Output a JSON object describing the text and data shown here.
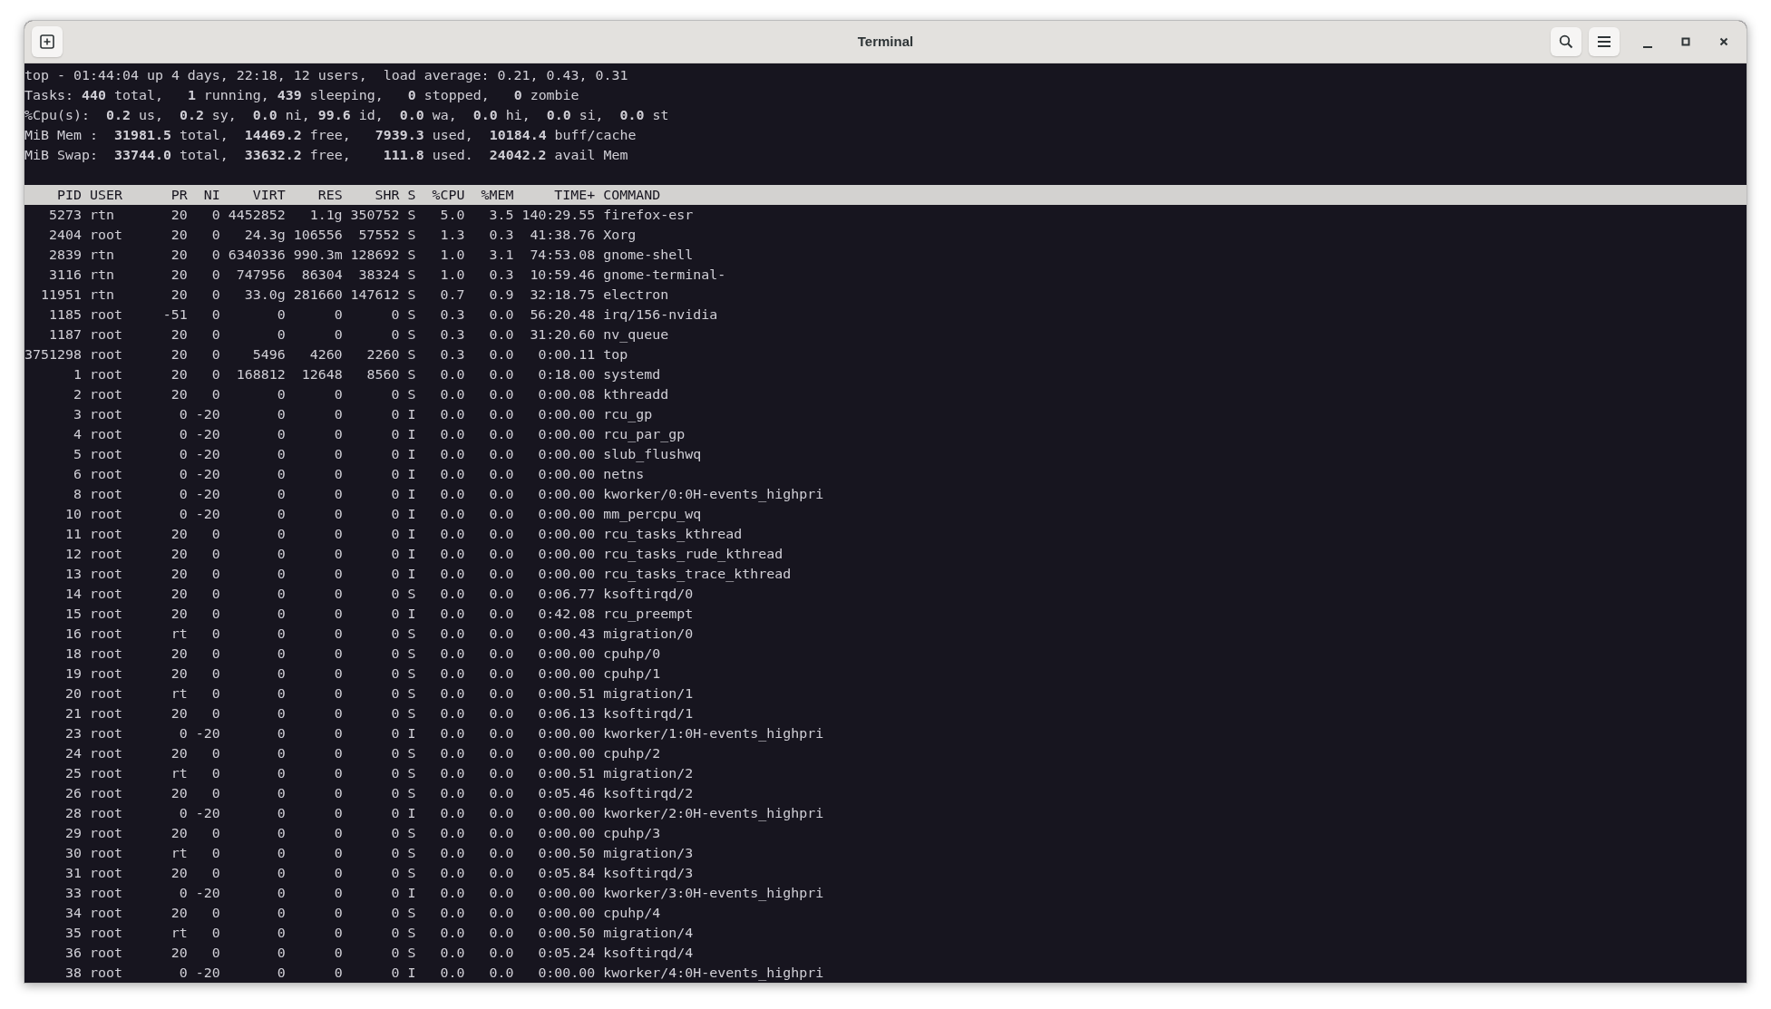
{
  "window": {
    "title": "Terminal"
  },
  "summary": [
    "top - 01:44:04 up 4 days, 22:18, 12 users,  load average: 0.21, 0.43, 0.31",
    "Tasks: **440** total,   **1** running, **439** sleeping,   **0** stopped,   **0** zombie",
    "%Cpu(s):  **0.2** us,  **0.2** sy,  **0.0** ni, **99.6** id,  **0.0** wa,  **0.0** hi,  **0.0** si,  **0.0** st",
    "MiB Mem :  **31981.5** total,  **14469.2** free,   **7939.3** used,  **10184.4** buff/cache",
    "MiB Swap:  **33744.0** total,  **33632.2** free,    **111.8** used.  **24042.2** avail Mem"
  ],
  "table": {
    "columns": [
      "PID",
      "USER",
      "PR",
      "NI",
      "VIRT",
      "RES",
      "SHR",
      "S",
      "%CPU",
      "%MEM",
      "TIME+",
      "COMMAND"
    ],
    "rows": [
      [
        "5273",
        "rtn",
        "20",
        "0",
        "4452852",
        "1.1g",
        "350752",
        "S",
        "5.0",
        "3.5",
        "140:29.55",
        "firefox-esr"
      ],
      [
        "2404",
        "root",
        "20",
        "0",
        "24.3g",
        "106556",
        "57552",
        "S",
        "1.3",
        "0.3",
        "41:38.76",
        "Xorg"
      ],
      [
        "2839",
        "rtn",
        "20",
        "0",
        "6340336",
        "990.3m",
        "128692",
        "S",
        "1.0",
        "3.1",
        "74:53.08",
        "gnome-shell"
      ],
      [
        "3116",
        "rtn",
        "20",
        "0",
        "747956",
        "86304",
        "38324",
        "S",
        "1.0",
        "0.3",
        "10:59.46",
        "gnome-terminal-"
      ],
      [
        "11951",
        "rtn",
        "20",
        "0",
        "33.0g",
        "281660",
        "147612",
        "S",
        "0.7",
        "0.9",
        "32:18.75",
        "electron"
      ],
      [
        "1185",
        "root",
        "-51",
        "0",
        "0",
        "0",
        "0",
        "S",
        "0.3",
        "0.0",
        "56:20.48",
        "irq/156-nvidia"
      ],
      [
        "1187",
        "root",
        "20",
        "0",
        "0",
        "0",
        "0",
        "S",
        "0.3",
        "0.0",
        "31:20.60",
        "nv_queue"
      ],
      [
        "3751298",
        "root",
        "20",
        "0",
        "5496",
        "4260",
        "2260",
        "S",
        "0.3",
        "0.0",
        "0:00.11",
        "top"
      ],
      [
        "1",
        "root",
        "20",
        "0",
        "168812",
        "12648",
        "8560",
        "S",
        "0.0",
        "0.0",
        "0:18.00",
        "systemd"
      ],
      [
        "2",
        "root",
        "20",
        "0",
        "0",
        "0",
        "0",
        "S",
        "0.0",
        "0.0",
        "0:00.08",
        "kthreadd"
      ],
      [
        "3",
        "root",
        "0",
        "-20",
        "0",
        "0",
        "0",
        "I",
        "0.0",
        "0.0",
        "0:00.00",
        "rcu_gp"
      ],
      [
        "4",
        "root",
        "0",
        "-20",
        "0",
        "0",
        "0",
        "I",
        "0.0",
        "0.0",
        "0:00.00",
        "rcu_par_gp"
      ],
      [
        "5",
        "root",
        "0",
        "-20",
        "0",
        "0",
        "0",
        "I",
        "0.0",
        "0.0",
        "0:00.00",
        "slub_flushwq"
      ],
      [
        "6",
        "root",
        "0",
        "-20",
        "0",
        "0",
        "0",
        "I",
        "0.0",
        "0.0",
        "0:00.00",
        "netns"
      ],
      [
        "8",
        "root",
        "0",
        "-20",
        "0",
        "0",
        "0",
        "I",
        "0.0",
        "0.0",
        "0:00.00",
        "kworker/0:0H-events_highpri"
      ],
      [
        "10",
        "root",
        "0",
        "-20",
        "0",
        "0",
        "0",
        "I",
        "0.0",
        "0.0",
        "0:00.00",
        "mm_percpu_wq"
      ],
      [
        "11",
        "root",
        "20",
        "0",
        "0",
        "0",
        "0",
        "I",
        "0.0",
        "0.0",
        "0:00.00",
        "rcu_tasks_kthread"
      ],
      [
        "12",
        "root",
        "20",
        "0",
        "0",
        "0",
        "0",
        "I",
        "0.0",
        "0.0",
        "0:00.00",
        "rcu_tasks_rude_kthread"
      ],
      [
        "13",
        "root",
        "20",
        "0",
        "0",
        "0",
        "0",
        "I",
        "0.0",
        "0.0",
        "0:00.00",
        "rcu_tasks_trace_kthread"
      ],
      [
        "14",
        "root",
        "20",
        "0",
        "0",
        "0",
        "0",
        "S",
        "0.0",
        "0.0",
        "0:06.77",
        "ksoftirqd/0"
      ],
      [
        "15",
        "root",
        "20",
        "0",
        "0",
        "0",
        "0",
        "I",
        "0.0",
        "0.0",
        "0:42.08",
        "rcu_preempt"
      ],
      [
        "16",
        "root",
        "rt",
        "0",
        "0",
        "0",
        "0",
        "S",
        "0.0",
        "0.0",
        "0:00.43",
        "migration/0"
      ],
      [
        "18",
        "root",
        "20",
        "0",
        "0",
        "0",
        "0",
        "S",
        "0.0",
        "0.0",
        "0:00.00",
        "cpuhp/0"
      ],
      [
        "19",
        "root",
        "20",
        "0",
        "0",
        "0",
        "0",
        "S",
        "0.0",
        "0.0",
        "0:00.00",
        "cpuhp/1"
      ],
      [
        "20",
        "root",
        "rt",
        "0",
        "0",
        "0",
        "0",
        "S",
        "0.0",
        "0.0",
        "0:00.51",
        "migration/1"
      ],
      [
        "21",
        "root",
        "20",
        "0",
        "0",
        "0",
        "0",
        "S",
        "0.0",
        "0.0",
        "0:06.13",
        "ksoftirqd/1"
      ],
      [
        "23",
        "root",
        "0",
        "-20",
        "0",
        "0",
        "0",
        "I",
        "0.0",
        "0.0",
        "0:00.00",
        "kworker/1:0H-events_highpri"
      ],
      [
        "24",
        "root",
        "20",
        "0",
        "0",
        "0",
        "0",
        "S",
        "0.0",
        "0.0",
        "0:00.00",
        "cpuhp/2"
      ],
      [
        "25",
        "root",
        "rt",
        "0",
        "0",
        "0",
        "0",
        "S",
        "0.0",
        "0.0",
        "0:00.51",
        "migration/2"
      ],
      [
        "26",
        "root",
        "20",
        "0",
        "0",
        "0",
        "0",
        "S",
        "0.0",
        "0.0",
        "0:05.46",
        "ksoftirqd/2"
      ],
      [
        "28",
        "root",
        "0",
        "-20",
        "0",
        "0",
        "0",
        "I",
        "0.0",
        "0.0",
        "0:00.00",
        "kworker/2:0H-events_highpri"
      ],
      [
        "29",
        "root",
        "20",
        "0",
        "0",
        "0",
        "0",
        "S",
        "0.0",
        "0.0",
        "0:00.00",
        "cpuhp/3"
      ],
      [
        "30",
        "root",
        "rt",
        "0",
        "0",
        "0",
        "0",
        "S",
        "0.0",
        "0.0",
        "0:00.50",
        "migration/3"
      ],
      [
        "31",
        "root",
        "20",
        "0",
        "0",
        "0",
        "0",
        "S",
        "0.0",
        "0.0",
        "0:05.84",
        "ksoftirqd/3"
      ],
      [
        "33",
        "root",
        "0",
        "-20",
        "0",
        "0",
        "0",
        "I",
        "0.0",
        "0.0",
        "0:00.00",
        "kworker/3:0H-events_highpri"
      ],
      [
        "34",
        "root",
        "20",
        "0",
        "0",
        "0",
        "0",
        "S",
        "0.0",
        "0.0",
        "0:00.00",
        "cpuhp/4"
      ],
      [
        "35",
        "root",
        "rt",
        "0",
        "0",
        "0",
        "0",
        "S",
        "0.0",
        "0.0",
        "0:00.50",
        "migration/4"
      ],
      [
        "36",
        "root",
        "20",
        "0",
        "0",
        "0",
        "0",
        "S",
        "0.0",
        "0.0",
        "0:05.24",
        "ksoftirqd/4"
      ],
      [
        "38",
        "root",
        "0",
        "-20",
        "0",
        "0",
        "0",
        "I",
        "0.0",
        "0.0",
        "0:00.00",
        "kworker/4:0H-events_highpri"
      ]
    ]
  }
}
